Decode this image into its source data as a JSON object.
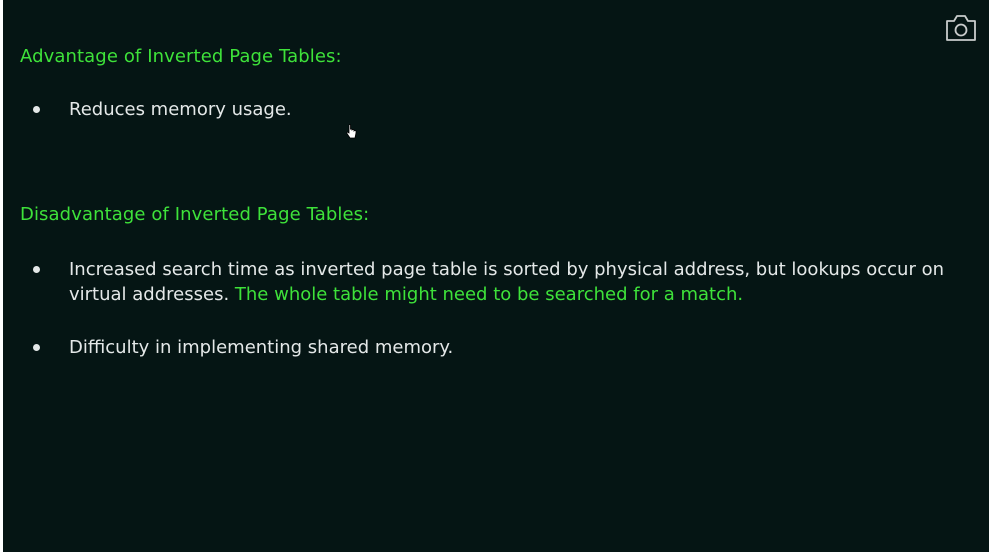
{
  "toolbar": {
    "camera_icon": "camera-icon"
  },
  "advantage": {
    "heading": "Advantage of Inverted Page Tables:",
    "items": [
      {
        "text": "Reduces memory usage."
      }
    ]
  },
  "disadvantage": {
    "heading": "Disadvantage of Inverted Page Tables:",
    "items": [
      {
        "text": "Increased search time as inverted page table is sorted by physical address, but lookups occur on virtual addresses.",
        "highlight": "The whole table might need to be searched for a match."
      },
      {
        "text": "Difficulty in implementing shared memory."
      }
    ]
  },
  "colors": {
    "background": "#051514",
    "heading": "#3ee23a",
    "text": "#e4e8e8"
  }
}
